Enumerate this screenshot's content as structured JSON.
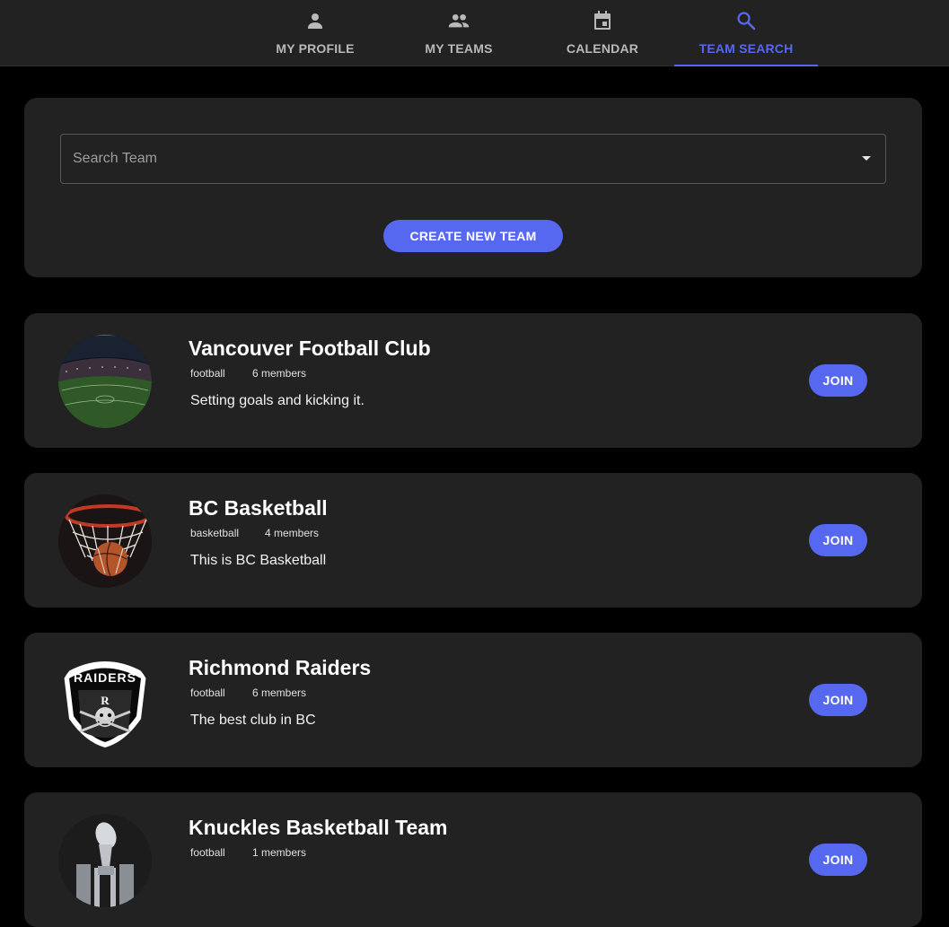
{
  "nav": {
    "tabs": [
      {
        "label": "MY PROFILE",
        "icon": "person-icon"
      },
      {
        "label": "MY TEAMS",
        "icon": "people-icon"
      },
      {
        "label": "CALENDAR",
        "icon": "calendar-icon"
      },
      {
        "label": "TEAM SEARCH",
        "icon": "search-icon",
        "active": true
      }
    ],
    "active_color": "#5668f0",
    "inactive_color": "#b9b9b9"
  },
  "search": {
    "placeholder": "Search Team",
    "create_label": "CREATE NEW TEAM"
  },
  "teams": [
    {
      "name": "Vancouver Football Club",
      "sport": "football",
      "members": "6 members",
      "description": "Setting goals and kicking it.",
      "avatar": "stadium-photo",
      "join_label": "JOIN"
    },
    {
      "name": "BC Basketball",
      "sport": "basketball",
      "members": "4 members",
      "description": "This is BC Basketball",
      "avatar": "basketball-hoop-photo",
      "join_label": "JOIN"
    },
    {
      "name": "Richmond Raiders",
      "sport": "football",
      "members": "6 members",
      "description": "The best club in BC",
      "avatar": "raiders-logo",
      "avatar_text": "RAIDERS",
      "join_label": "JOIN"
    },
    {
      "name": "Knuckles Basketball Team",
      "sport": "football",
      "members": "1 members",
      "description": "",
      "avatar": "trophy-logo",
      "join_label": "JOIN"
    }
  ],
  "colors": {
    "background": "#000000",
    "surface": "#222222",
    "accent": "#5668f0"
  }
}
